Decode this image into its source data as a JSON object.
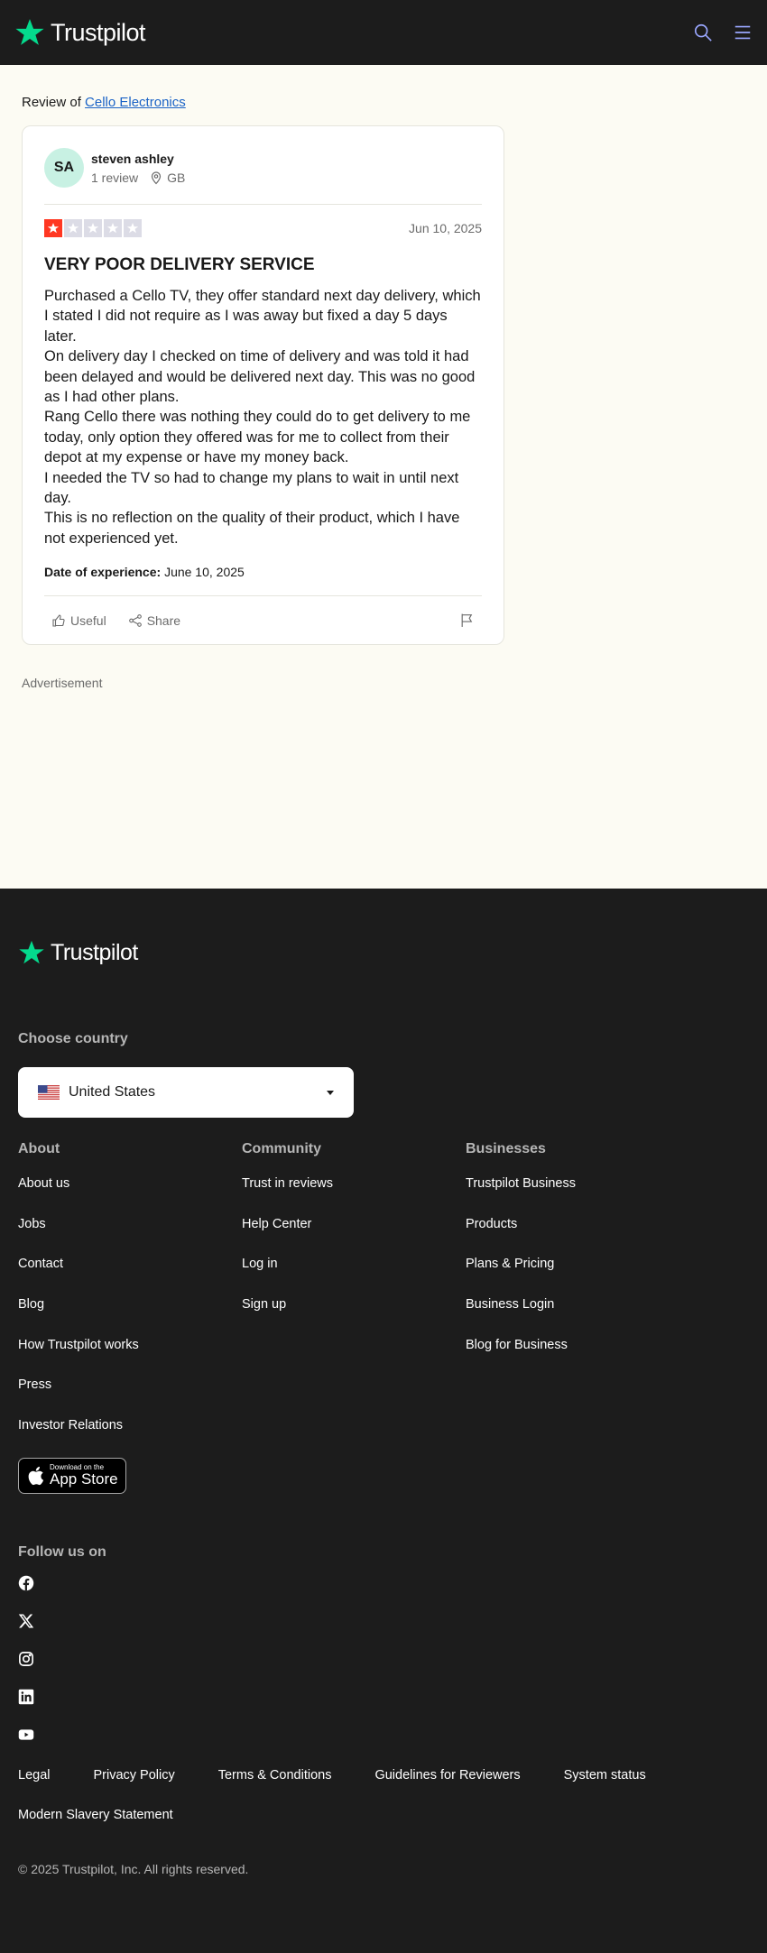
{
  "header": {
    "brand": "Trustpilot",
    "search_icon": "search-icon",
    "menu_icon": "hamburger-menu-icon"
  },
  "review_of": {
    "prefix": "Review of",
    "business": "Cello Electronics"
  },
  "review": {
    "avatar_initials": "SA",
    "consumer_name": "steven ashley",
    "review_count": "1 review",
    "country": "GB",
    "rating": 1,
    "rating_max": 5,
    "date": "Jun 10, 2025",
    "title": "VERY POOR DELIVERY SERVICE",
    "body": [
      "Purchased a Cello TV, they offer standard next day delivery, which I stated I did not require as I was away but fixed a day 5 days later.",
      "On delivery day I checked on time of delivery and was told it had been delayed and would be delivered next day. This was no good as I had other plans.",
      "Rang Cello there was nothing they could do to get delivery to me today, only option they offered was for me to collect from their depot at my expense or have my money back.",
      "I needed the TV so had to change my plans to wait in until next day.",
      "This is no reflection on the quality of their product, which I have not experienced yet."
    ],
    "experience_label": "Date of experience:",
    "experience_date": "June 10, 2025",
    "useful_label": "Useful",
    "share_label": "Share"
  },
  "advertisement_label": "Advertisement",
  "colors": {
    "star_green": "#04da8d",
    "rating_red": "#ff3722",
    "empty_star": "#dcdce6",
    "link_blue": "#1b63c6"
  },
  "footer": {
    "brand": "Trustpilot",
    "choose_country": "Choose country",
    "country": "United States",
    "columns": [
      {
        "heading": "About",
        "links": [
          "About us",
          "Jobs",
          "Contact",
          "Blog",
          "How Trustpilot works",
          "Press",
          "Investor Relations"
        ]
      },
      {
        "heading": "Community",
        "links": [
          "Trust in reviews",
          "Help Center",
          "Log in",
          "Sign up"
        ]
      },
      {
        "heading": "Businesses",
        "links": [
          "Trustpilot Business",
          "Products",
          "Plans & Pricing",
          "Business Login",
          "Blog for Business"
        ]
      }
    ],
    "app_store": {
      "small": "Download on the",
      "big": "App Store"
    },
    "follow_us": "Follow us on",
    "socials": [
      "facebook-icon",
      "x-icon",
      "instagram-icon",
      "linkedin-icon",
      "youtube-icon"
    ],
    "legal_links": [
      "Legal",
      "Privacy Policy",
      "Terms & Conditions",
      "Guidelines for Reviewers",
      "System status",
      "Modern Slavery Statement"
    ],
    "copyright": "© 2025 Trustpilot, Inc. All rights reserved."
  }
}
